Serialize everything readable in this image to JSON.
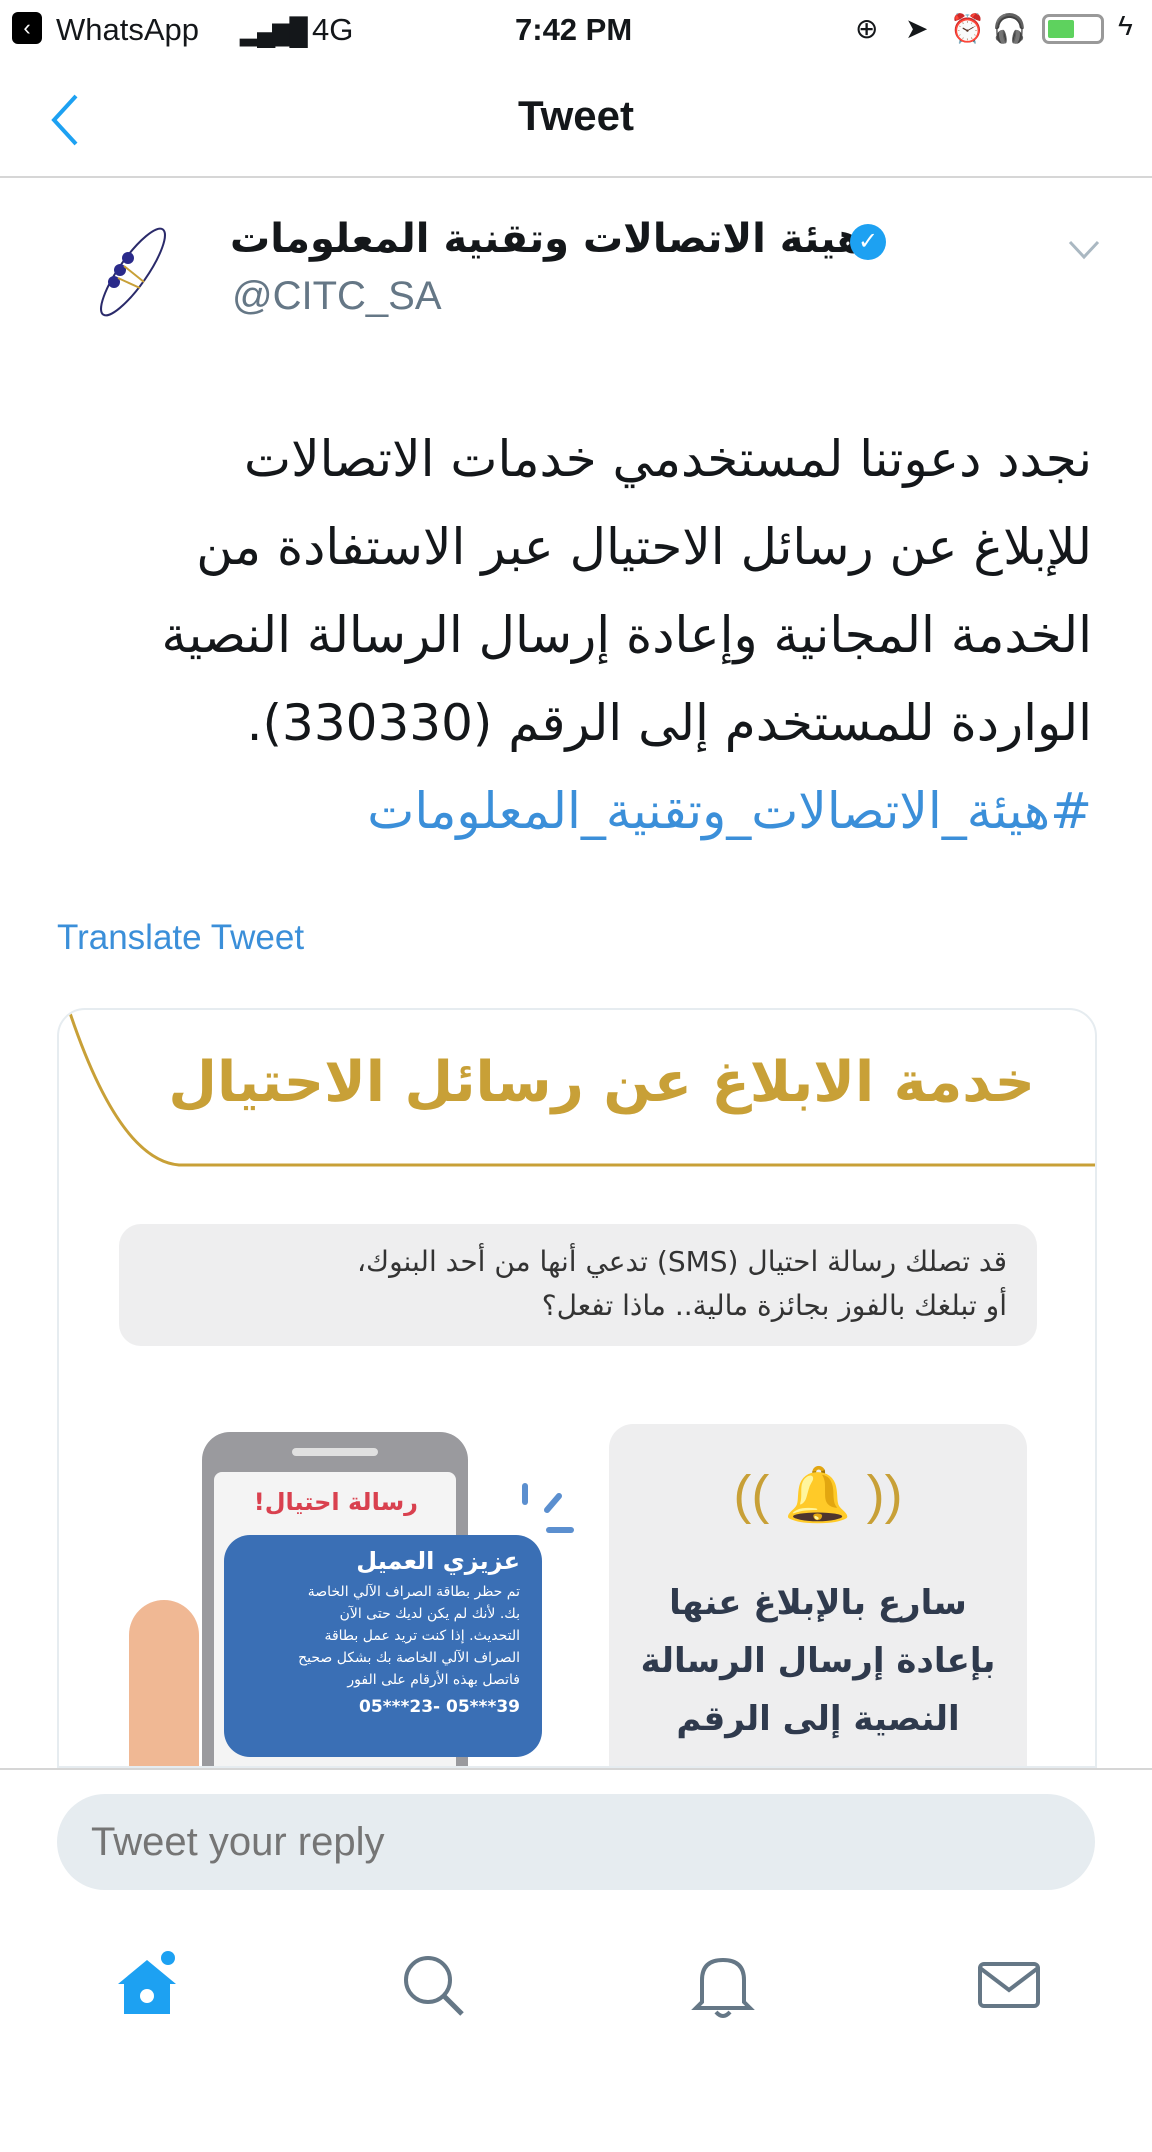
{
  "status_bar": {
    "back_app": "WhatsApp",
    "network": "4G",
    "time": "7:42 PM"
  },
  "header": {
    "title": "Tweet"
  },
  "tweet": {
    "author_name": "هيئة الاتصالات وتقنية المعلومات",
    "handle": "@CITC_SA",
    "verified": true,
    "lines": [
      "نجدد دعوتنا لمستخدمي خدمات الاتصالات",
      "للإبلاغ عن رسائل الاحتيال عبر الاستفادة من",
      "الخدمة المجانية وإعادة إرسال الرسالة النصية",
      "الواردة للمستخدم إلى الرقم (330330)."
    ],
    "hashtag": "#هيئة_الاتصالات_وتقنية_المعلومات",
    "translate": "Translate Tweet"
  },
  "card": {
    "title": "خدمة الابلاغ عن رسائل الاحتيال",
    "bubble_line1": "قد تصلك رسالة احتيال (SMS) تدعي أنها من أحد البنوك،",
    "bubble_line2": "أو تبلغك بالفوز بجائزة مالية.. ماذا تفعل؟",
    "phone_label": "رسالة احتيال!",
    "sms_title": "عزيزي العميل",
    "sms_body": [
      "تم حظر بطاقة الصراف الآلي الخاصة",
      "بك. لأنك لم يكن لديك حتى الآن",
      "التحديث. إذا كنت تريد عمل بطاقة",
      "الصراف الآلي الخاصة بك بشكل صحيح",
      "فاتصل بهذه الأرقام على الفور"
    ],
    "sms_numbers": "05***23- 05***39",
    "panel_lines": [
      "سارع بالإبلاغ عنها",
      "بإعادة إرسال الرسالة",
      "النصية إلى الرقم"
    ],
    "colors": {
      "gold": "#c8a037",
      "blue": "#3a6fb5",
      "red": "#d9414f"
    }
  },
  "reply": {
    "placeholder": "Tweet your reply"
  },
  "tabs": [
    "home",
    "search",
    "notifications",
    "messages"
  ],
  "colors": {
    "accent": "#1da1f2",
    "link": "#3b8fd9"
  }
}
